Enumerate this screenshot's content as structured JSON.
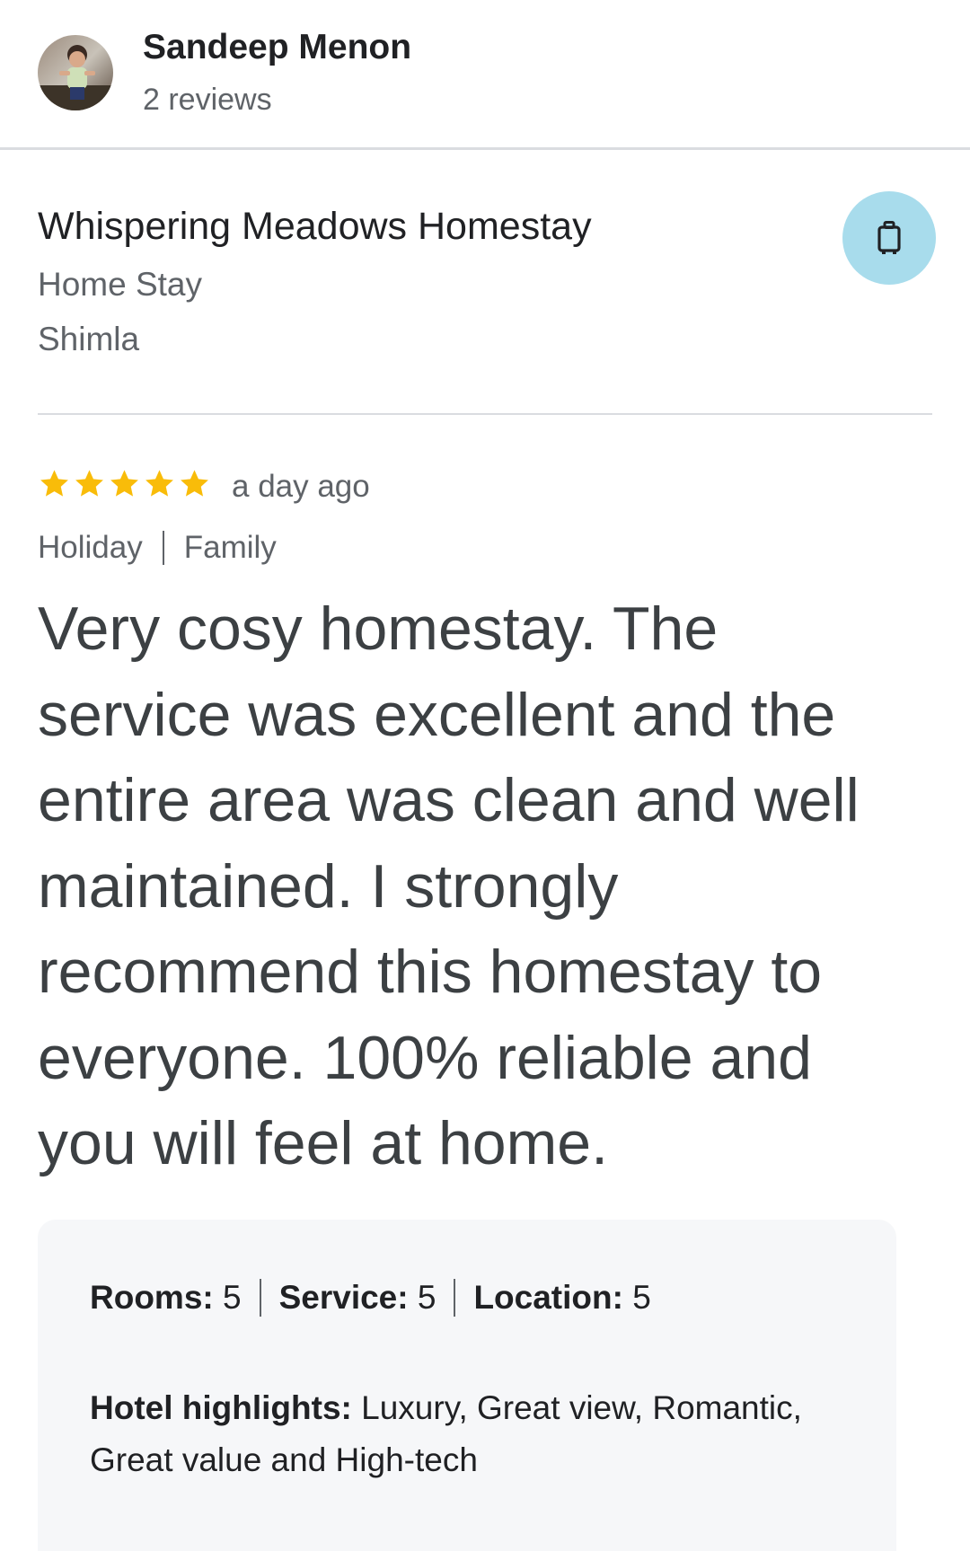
{
  "reviewer": {
    "name": "Sandeep Menon",
    "review_count": "2 reviews"
  },
  "place": {
    "name": "Whispering Meadows Homestay",
    "type": "Home Stay",
    "location": "Shimla",
    "icon": "luggage-icon",
    "icon_bg_color": "#a8dcec"
  },
  "review": {
    "rating": 5,
    "rating_max": 5,
    "star_color": "#f9bc09",
    "time_ago": "a day ago",
    "tags": [
      "Holiday",
      "Family"
    ],
    "text": "Very cosy homestay. The service was excellent and the entire area was clean and well maintained. I strongly recommend this homestay to everyone. 100% reliable and you will feel at home."
  },
  "sub_ratings": [
    {
      "label": "Rooms:",
      "value": "5"
    },
    {
      "label": "Service:",
      "value": "5"
    },
    {
      "label": "Location:",
      "value": "5"
    }
  ],
  "highlights": {
    "label": "Hotel highlights:",
    "text": "Luxury, Great view, Romantic, Great value and High-tech"
  }
}
